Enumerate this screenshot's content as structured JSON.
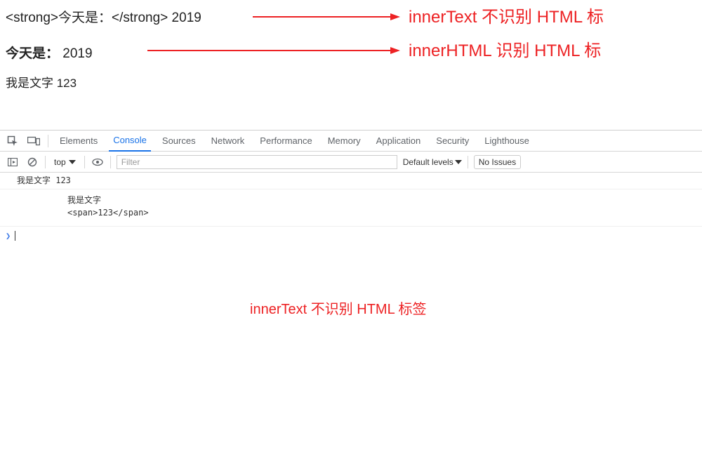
{
  "page": {
    "line1": "<strong>今天是：</strong> 2019",
    "line2_bold": "今天是：",
    "line2_rest": " 2019",
    "line3": "我是文字 123"
  },
  "annotations": {
    "label1": "innerText 不识别 HTML 标",
    "label2": "innerHTML 识别 HTML 标",
    "center": "innerText 不识别 HTML 标签"
  },
  "devtools": {
    "tabs": {
      "elements": "Elements",
      "console": "Console",
      "sources": "Sources",
      "network": "Network",
      "performance": "Performance",
      "memory": "Memory",
      "application": "Application",
      "security": "Security",
      "lighthouse": "Lighthouse"
    },
    "toolbar": {
      "context": "top",
      "filter_placeholder": "Filter",
      "levels": "Default levels",
      "issues": "No Issues"
    },
    "console": {
      "log1": "我是文字 123",
      "log2_line1": "我是文字",
      "log2_line2": "<span>123</span>"
    }
  }
}
